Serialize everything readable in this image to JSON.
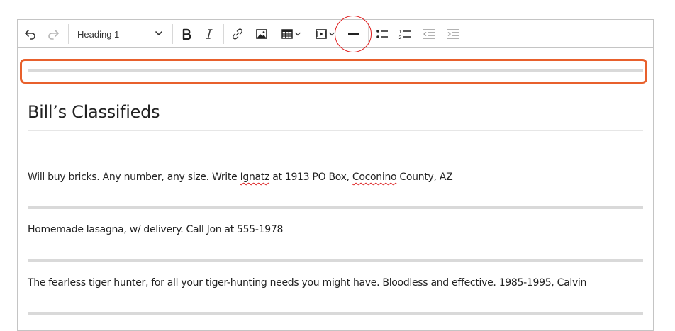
{
  "editor": {
    "toolbar": {
      "heading_value": "Heading 1",
      "icons": [
        "undo-icon",
        "redo-icon",
        "chevron-down-icon",
        "bold-icon",
        "italic-icon",
        "link-icon",
        "image-icon",
        "table-icon",
        "media-icon",
        "horizontal-line-icon",
        "bulleted-list-icon",
        "numbered-list-icon",
        "outdent-icon",
        "indent-icon"
      ]
    },
    "content": {
      "heading": "Bill’s Classifieds",
      "ads": [
        {
          "before": "Will buy bricks. Any number, any size. Write ",
          "misspelled1": "Ignatz",
          "middle": " at 1913 PO Box, ",
          "misspelled2": "Coconino",
          "after": " County, AZ"
        },
        {
          "text": "Homemade lasagna, w/ delivery. Call Jon at 555-1978"
        },
        {
          "text": "The fearless tiger hunter, for all your tiger-hunting needs you might have. Bloodless and effective. 1985-1995, Calvin"
        }
      ]
    }
  },
  "annotations": {
    "circle_color": "#e02020",
    "rect_color": "#e8602c"
  }
}
